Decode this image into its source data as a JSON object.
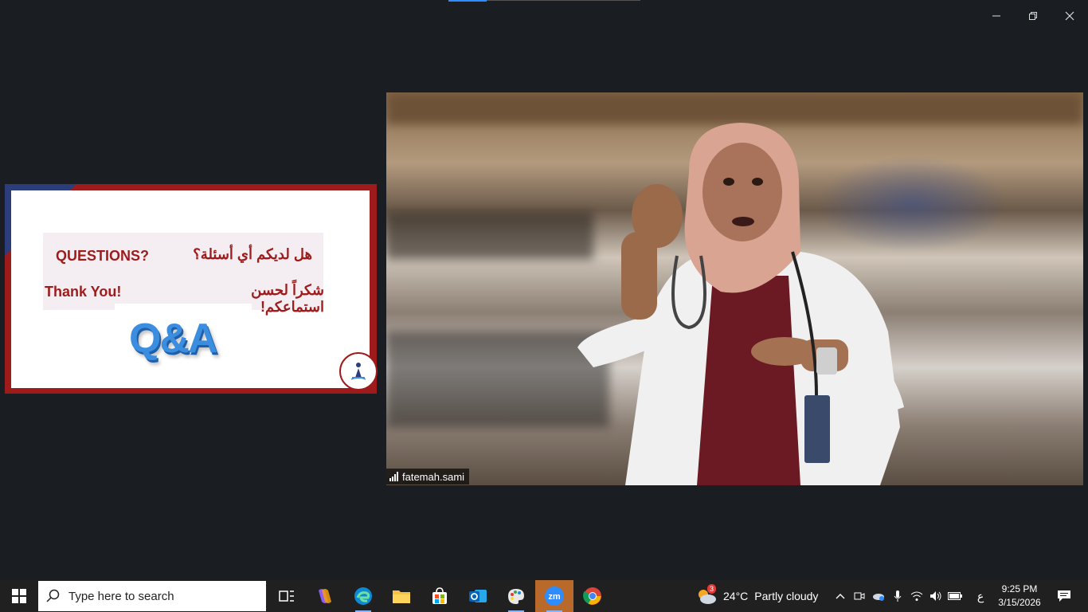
{
  "window": {
    "minimize_icon": "minimize-icon",
    "restore_icon": "restore-icon",
    "close_icon": "close-icon"
  },
  "shared_slide": {
    "questions_en": "QUESTIONS?",
    "questions_ar": "هل لديكم أي أسئلة؟",
    "thanks_en": "Thank You!",
    "thanks_ar": "شكراً لحسن استماعكم!",
    "logo_text": "Q&A",
    "accent_color": "#9e1b1b",
    "secondary_color": "#2b3d7a"
  },
  "video": {
    "participant_name": "fatemah.sami"
  },
  "taskbar": {
    "search_placeholder": "Type here to search",
    "weather_temp": "24°C",
    "weather_desc": "Partly cloudy",
    "weather_badge": "3",
    "ime_indicator": "ع",
    "time": "9:25 PM",
    "date": "3/15/2026",
    "apps": [
      "task-view",
      "copilot",
      "edge",
      "file-explorer",
      "microsoft-store",
      "outlook",
      "paint",
      "zoom",
      "chrome"
    ]
  }
}
